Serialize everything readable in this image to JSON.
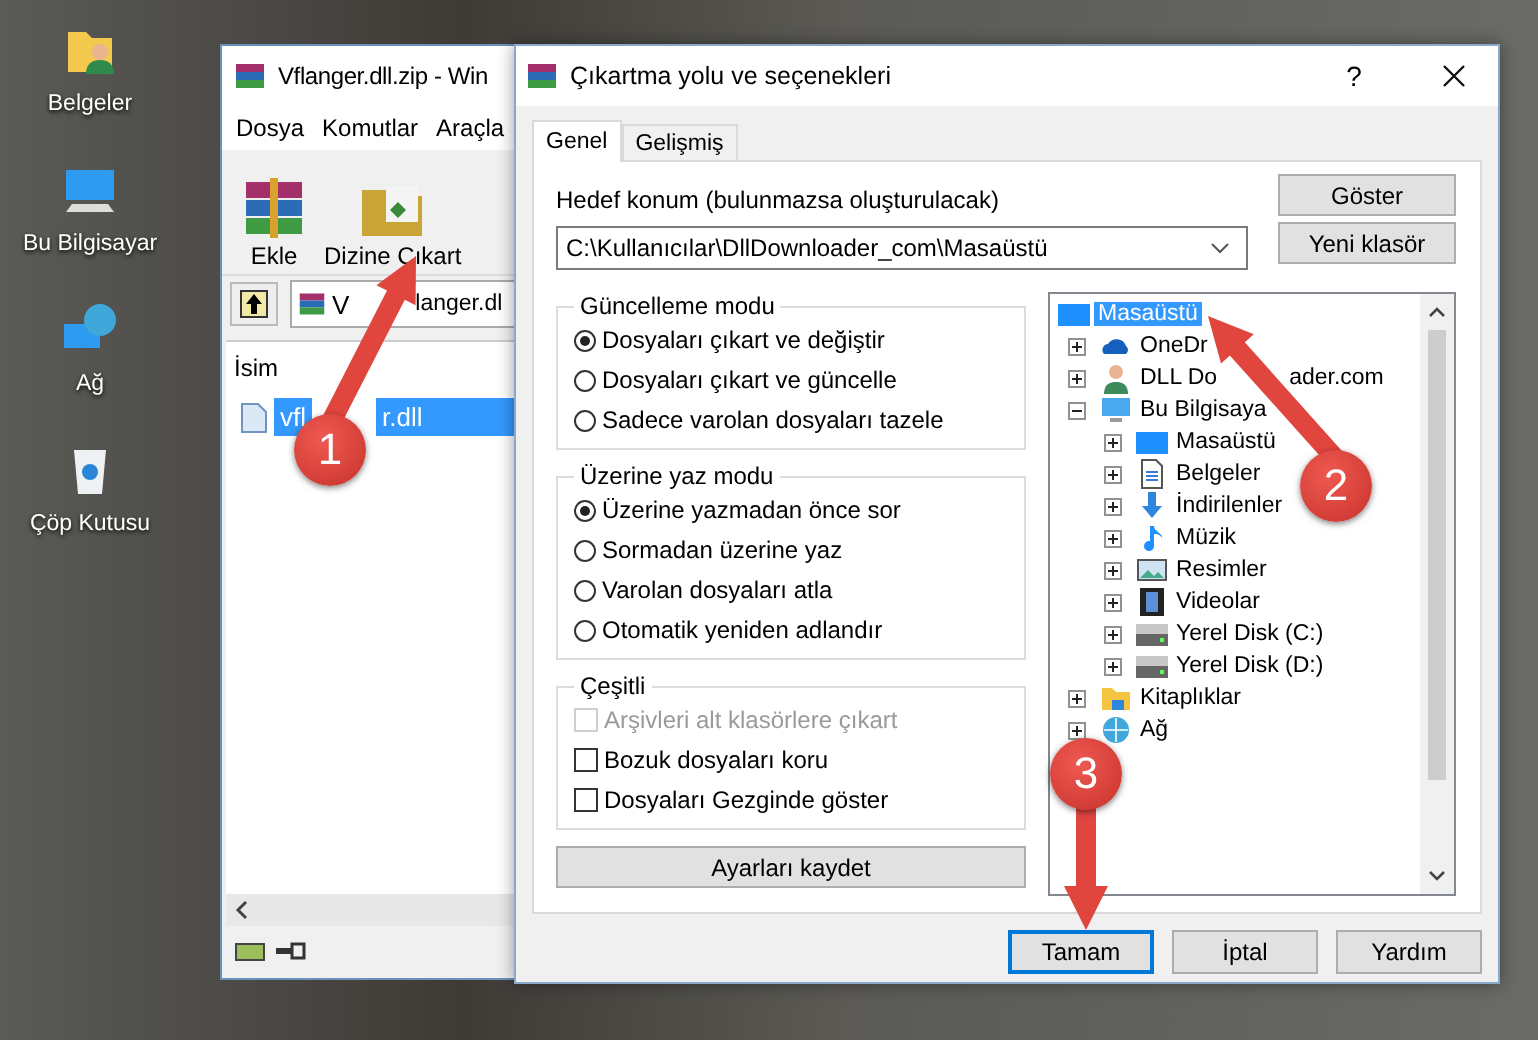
{
  "desktop_icons": [
    {
      "label": "Belgeler",
      "kind": "documents"
    },
    {
      "label": "Bu Bilgisayar",
      "kind": "computer"
    },
    {
      "label": "Ağ",
      "kind": "network"
    },
    {
      "label": "Çöp Kutusu",
      "kind": "recycle"
    }
  ],
  "archiver_window": {
    "title": "Vflanger.dll.zip - Win",
    "menu": [
      "Dosya",
      "Komutlar",
      "Araçla"
    ],
    "toolbar": [
      {
        "label": "Ekle",
        "kind": "archive"
      },
      {
        "label": "Dizine Çıkart",
        "kind": "extract"
      }
    ],
    "address_parts": [
      "V",
      "langer.dl"
    ],
    "column": "İsim",
    "files": [
      {
        "name_parts": [
          "vfl",
          "r.dll"
        ],
        "selected": true
      }
    ]
  },
  "dialog": {
    "title": "Çıkartma yolu ve seçenekleri",
    "help_button": "?",
    "tabs": [
      {
        "label": "Genel",
        "selected": true
      },
      {
        "label": "Gelişmiş",
        "selected": false
      }
    ],
    "destination": {
      "label": "Hedef konum (bulunmazsa oluşturulacak)",
      "value": "C:\\Kullanıcılar\\DllDownloader_com\\Masaüstü"
    },
    "side_buttons": [
      "Göster",
      "Yeni klasör"
    ],
    "groups": [
      {
        "title": "Güncelleme modu",
        "items": [
          {
            "kind": "radio",
            "label": "Dosyaları çıkart ve değiştir",
            "selected": true
          },
          {
            "kind": "radio",
            "label": "Dosyaları çıkart ve güncelle",
            "selected": false
          },
          {
            "kind": "radio",
            "label": "Sadece varolan dosyaları tazele",
            "selected": false
          }
        ]
      },
      {
        "title": "Üzerine yaz modu",
        "items": [
          {
            "kind": "radio",
            "label": "Üzerine yazmadan önce sor",
            "selected": true
          },
          {
            "kind": "radio",
            "label": "Sormadan üzerine yaz",
            "selected": false
          },
          {
            "kind": "radio",
            "label": "Varolan dosyaları atla",
            "selected": false
          },
          {
            "kind": "radio",
            "label": "Otomatik yeniden adlandır",
            "selected": false
          }
        ]
      },
      {
        "title": "Çeşitli",
        "items": [
          {
            "kind": "checkbox",
            "label": "Arşivleri alt klasörlere çıkart",
            "checked": false,
            "disabled": true
          },
          {
            "kind": "checkbox",
            "label": "Bozuk dosyaları koru",
            "checked": false,
            "disabled": false
          },
          {
            "kind": "checkbox",
            "label": "Dosyaları Gezginde göster",
            "checked": false,
            "disabled": false
          }
        ]
      }
    ],
    "save_button": "Ayarları kaydet",
    "tree": [
      {
        "label": "Masaüstü",
        "kind": "desktop",
        "selected": true,
        "children": [
          {
            "label": "OneDr",
            "kind": "cloud",
            "selected": false,
            "expanded": false
          },
          {
            "label": "DLL Do",
            "label_tail": "ader.com",
            "kind": "person",
            "selected": false,
            "expanded": false
          },
          {
            "label": "Bu Bilgisaya",
            "kind": "computer",
            "selected": false,
            "expanded": true,
            "children": [
              {
                "label": "Masaüstü",
                "kind": "desktop",
                "selected": false,
                "expanded": false
              },
              {
                "label": "Belgeler",
                "kind": "document",
                "selected": false,
                "expanded": false
              },
              {
                "label": "İndirilenler",
                "kind": "download",
                "selected": false,
                "expanded": false
              },
              {
                "label": "Müzik",
                "kind": "music",
                "selected": false,
                "expanded": false
              },
              {
                "label": "Resimler",
                "kind": "picture",
                "selected": false,
                "expanded": false
              },
              {
                "label": "Videolar",
                "kind": "film",
                "selected": false,
                "expanded": false
              },
              {
                "label": "Yerel Disk (C:)",
                "kind": "drive",
                "selected": false,
                "expanded": false
              },
              {
                "label": "Yerel Disk (D:)",
                "kind": "drive",
                "selected": false,
                "expanded": false
              }
            ]
          },
          {
            "label": "Kitaplıklar",
            "kind": "folder",
            "selected": false,
            "expanded": false
          },
          {
            "label": "Ağ",
            "kind": "globe",
            "selected": false,
            "expanded": false
          }
        ]
      }
    ],
    "footer_buttons": [
      {
        "label": "Tamam",
        "focused": true
      },
      {
        "label": "İptal",
        "focused": false
      },
      {
        "label": "Yardım",
        "focused": false
      }
    ]
  },
  "annotations": [
    {
      "number": "1"
    },
    {
      "number": "2"
    },
    {
      "number": "3"
    }
  ]
}
